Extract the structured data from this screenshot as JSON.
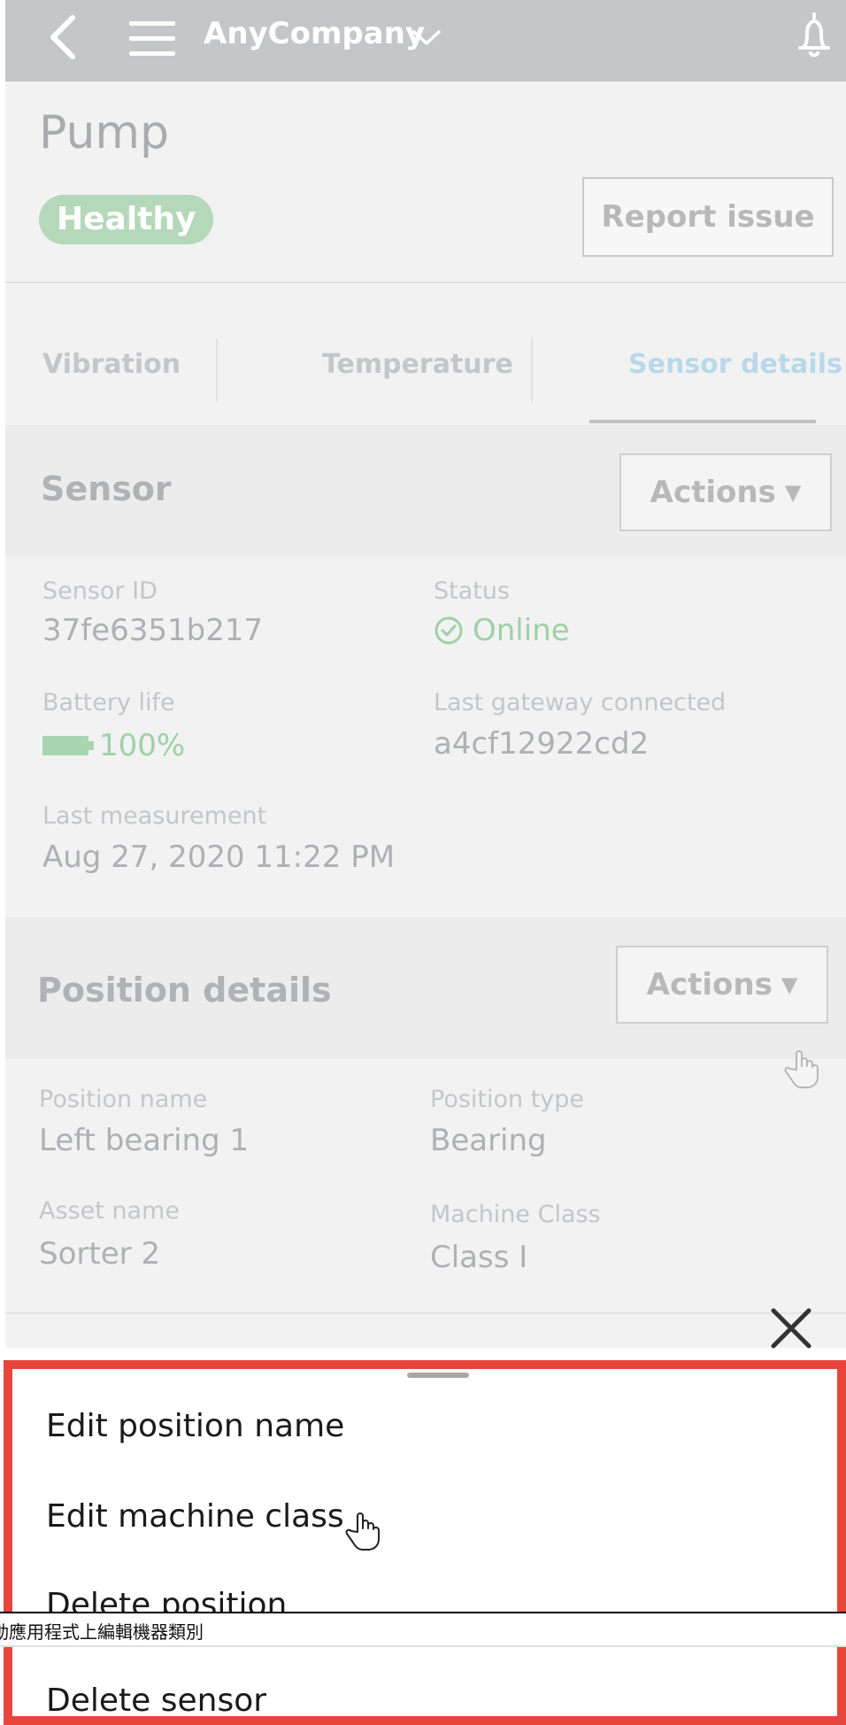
{
  "topbar": {
    "brand": "AnyCompany"
  },
  "asset": {
    "title": "Pump",
    "health": "Healthy",
    "report_button": "Report issue"
  },
  "tabs": [
    {
      "label": "Vibration"
    },
    {
      "label": "Temperature"
    },
    {
      "label": "Sensor details",
      "active": true
    }
  ],
  "sensor": {
    "title": "Sensor",
    "actions_label": "Actions",
    "sensor_id_label": "Sensor ID",
    "sensor_id": "37fe6351b217",
    "status_label": "Status",
    "status": "Online",
    "battery_label": "Battery life",
    "battery": "100%",
    "gateway_label": "Last gateway connected",
    "gateway": "a4cf12922cd2",
    "last_measurement_label": "Last measurement",
    "last_measurement": "Aug 27, 2020 11:22 PM"
  },
  "position": {
    "title": "Position details",
    "actions_label": "Actions",
    "name_label": "Position name",
    "name": "Left bearing 1",
    "type_label": "Position type",
    "type": "Bearing",
    "asset_label": "Asset name",
    "asset": "Sorter 2",
    "class_label": "Machine Class",
    "class": "Class I"
  },
  "sheet": {
    "items": [
      {
        "label": "Edit position name"
      },
      {
        "label": "Edit machine class"
      },
      {
        "label": "Delete position"
      },
      {
        "label": "Delete sensor"
      }
    ]
  },
  "caption": "動應用程式上編輯機器類別",
  "colors": {
    "highlight": "#e8453c",
    "healthy": "#b6d8ba",
    "online": "#9fd0a8",
    "active_tab": "#b9d8ea"
  }
}
